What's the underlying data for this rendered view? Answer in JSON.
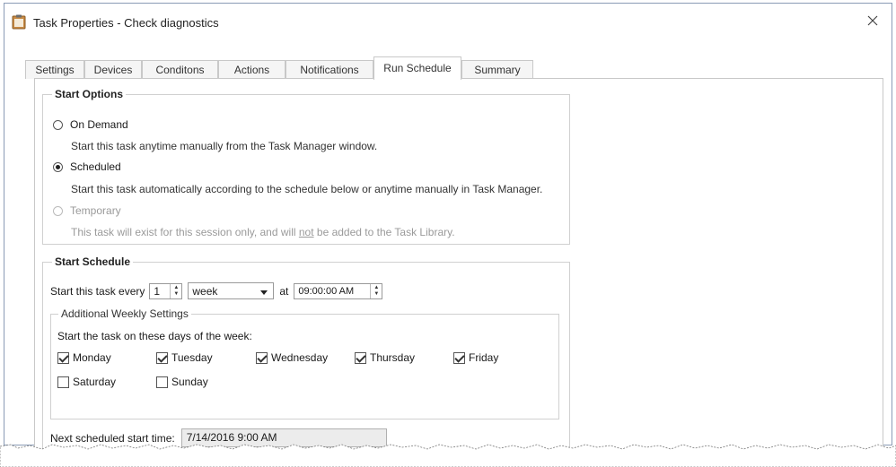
{
  "window": {
    "title": "Task Properties - Check diagnostics",
    "close_label": "×"
  },
  "tabs": [
    {
      "label": "Settings",
      "active": false
    },
    {
      "label": "Devices",
      "active": false
    },
    {
      "label": "Conditons",
      "active": false
    },
    {
      "label": "Actions",
      "active": false
    },
    {
      "label": "Notifications",
      "active": false
    },
    {
      "label": "Run Schedule",
      "active": true
    },
    {
      "label": "Summary",
      "active": false
    }
  ],
  "start_options": {
    "title": "Start Options",
    "on_demand": {
      "label": "On Demand",
      "checked": false,
      "desc": "Start this task anytime manually from the Task Manager window."
    },
    "scheduled": {
      "label": "Scheduled",
      "checked": true,
      "desc": "Start this task automatically according to the schedule below or anytime manually in Task Manager."
    },
    "temporary": {
      "label": "Temporary",
      "checked": false,
      "disabled": true,
      "desc_before": "This task will exist for this session only, and will ",
      "desc_emph": "not",
      "desc_after": " be added to the Task Library."
    }
  },
  "start_schedule": {
    "title": "Start Schedule",
    "every_label": "Start this task every",
    "interval_value": "1",
    "unit_value": "week",
    "at_label": "at",
    "time_value": "09:00:00 AM",
    "weekly": {
      "title": "Additional Weekly Settings",
      "prompt": "Start the task on these days of the week:",
      "days": [
        {
          "label": "Monday",
          "checked": true
        },
        {
          "label": "Tuesday",
          "checked": true
        },
        {
          "label": "Wednesday",
          "checked": true
        },
        {
          "label": "Thursday",
          "checked": true
        },
        {
          "label": "Friday",
          "checked": true
        },
        {
          "label": "Saturday",
          "checked": false
        },
        {
          "label": "Sunday",
          "checked": false
        }
      ]
    },
    "next_label": "Next scheduled start time:",
    "next_value": "7/14/2016 9:00 AM"
  },
  "colors": {
    "border": "#c8c8c8",
    "window_border": "#8a9bb5",
    "disabled": "#9a9a9a",
    "icon": "#b07a3c"
  },
  "icons": {
    "app": "clipboard-icon",
    "close": "close-icon",
    "dropdown": "chevron-down-icon",
    "spinner": "spinner-arrows-icon"
  }
}
